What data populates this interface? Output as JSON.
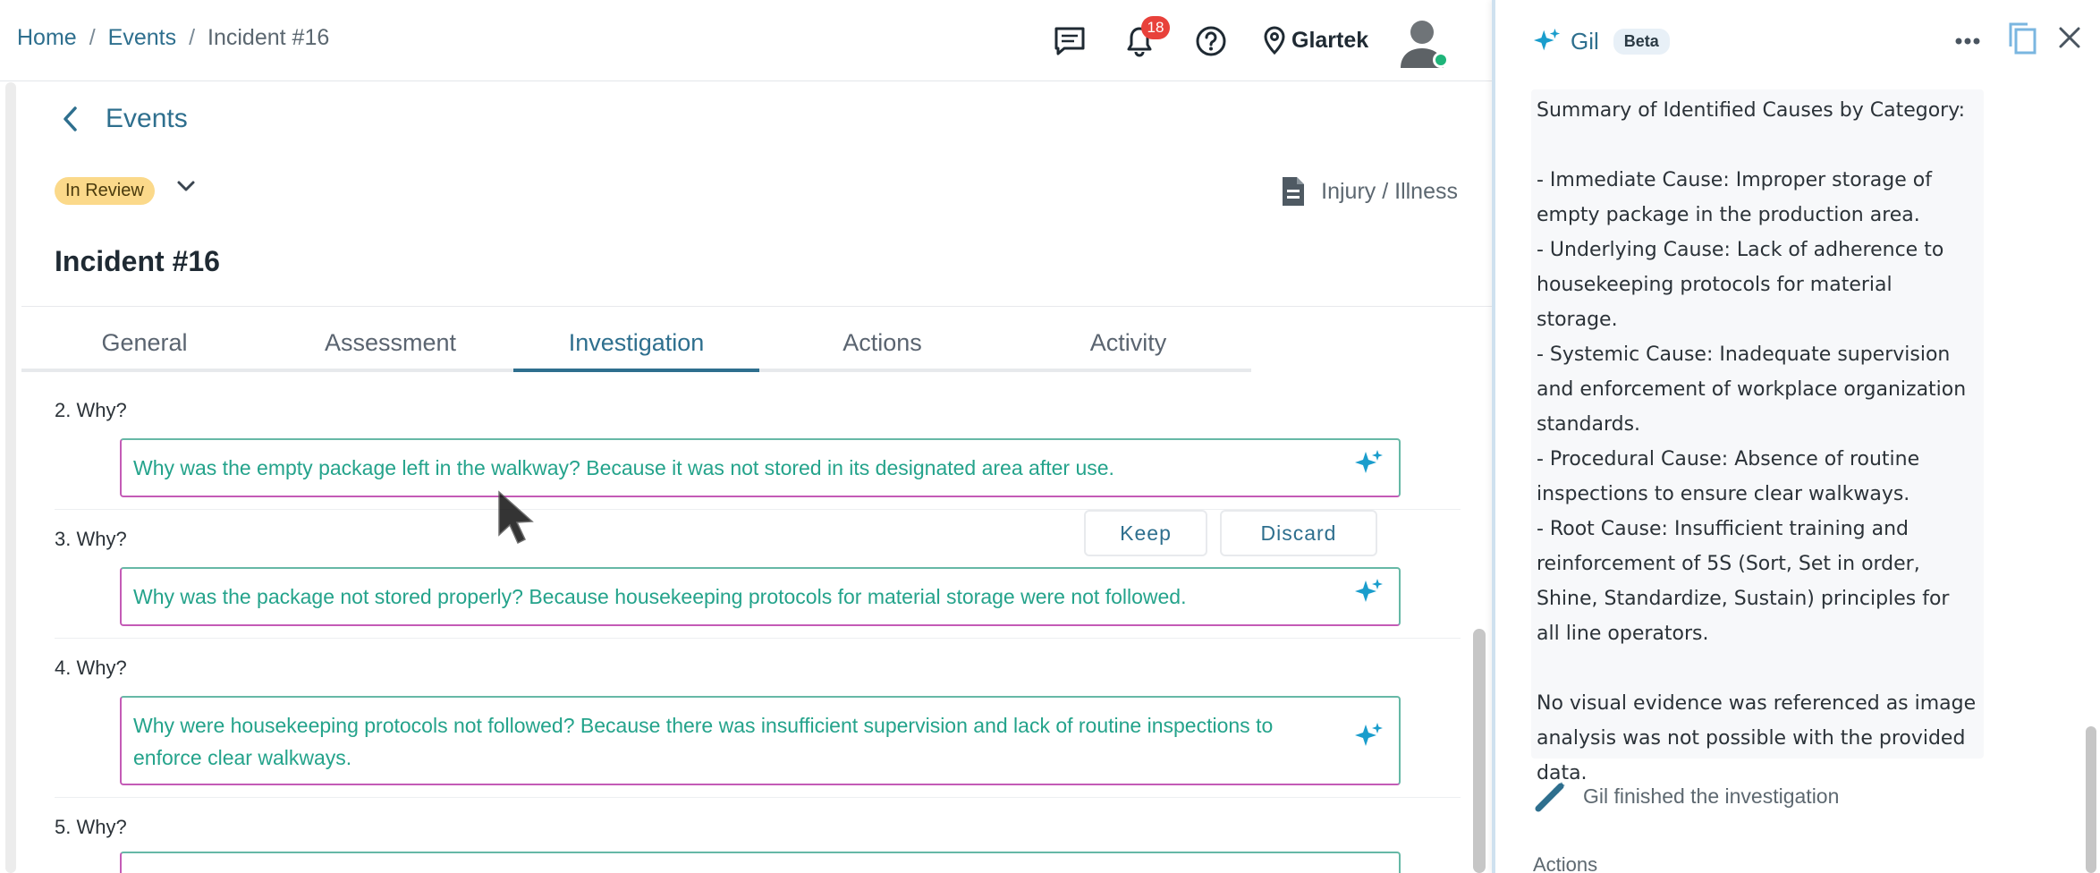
{
  "breadcrumb": {
    "home": "Home",
    "sep1": "/",
    "events": "Events",
    "sep2": "/",
    "current": "Incident #16"
  },
  "topbar": {
    "notifications_count": "18",
    "site_name": "Glartek",
    "icons": [
      "chat-icon",
      "bell-icon",
      "help-icon",
      "location-pin-icon",
      "user-avatar"
    ]
  },
  "page": {
    "back_label": "Events",
    "status": "In Review",
    "event_type": "Injury / Illness",
    "title": "Incident #16"
  },
  "tabs": [
    {
      "label": "General",
      "active": false
    },
    {
      "label": "Assessment",
      "active": false
    },
    {
      "label": "Investigation",
      "active": true
    },
    {
      "label": "Actions",
      "active": false
    },
    {
      "label": "Activity",
      "active": false
    }
  ],
  "whys": [
    {
      "label": "2. Why?",
      "answer": "Why was the empty package left in the walkway? Because it was not stored in its designated area after use."
    },
    {
      "label": "3. Why?",
      "answer": "Why was the package not stored properly? Because housekeeping protocols for material storage were not followed."
    },
    {
      "label": "4. Why?",
      "answer": "Why were housekeeping protocols not followed? Because there was insufficient supervision and lack of routine inspections to enforce clear walkways."
    },
    {
      "label": "5. Why?",
      "answer": ""
    }
  ],
  "suggestion": {
    "keep_label": "Keep",
    "discard_label": "Discard"
  },
  "panel": {
    "assistant_name": "Gil",
    "beta_label": "Beta",
    "summary_lines": [
      "Summary of Identified Causes by Category:",
      "",
      "- Immediate Cause: Improper storage of empty package in the production area.",
      "- Underlying Cause: Lack of adherence to housekeeping protocols for material storage.",
      "- Systemic Cause: Inadequate supervision and enforcement of workplace organization standards.",
      "- Procedural Cause: Absence of routine inspections to ensure clear walkways.",
      "- Root Cause: Insufficient training and reinforcement of 5S (Sort, Set in order, Shine, Standardize, Sustain) principles for all line operators.",
      "",
      "No visual evidence was referenced as image analysis was not possible with the provided data."
    ],
    "finished_label": "Gil finished the investigation",
    "actions_label": "Actions"
  },
  "colors": {
    "accent": "#2e6f8e",
    "answer_text": "#24a38b",
    "status_bg": "#fbd98a",
    "badge": "#e8413b",
    "spark": "#1a9dcc"
  }
}
